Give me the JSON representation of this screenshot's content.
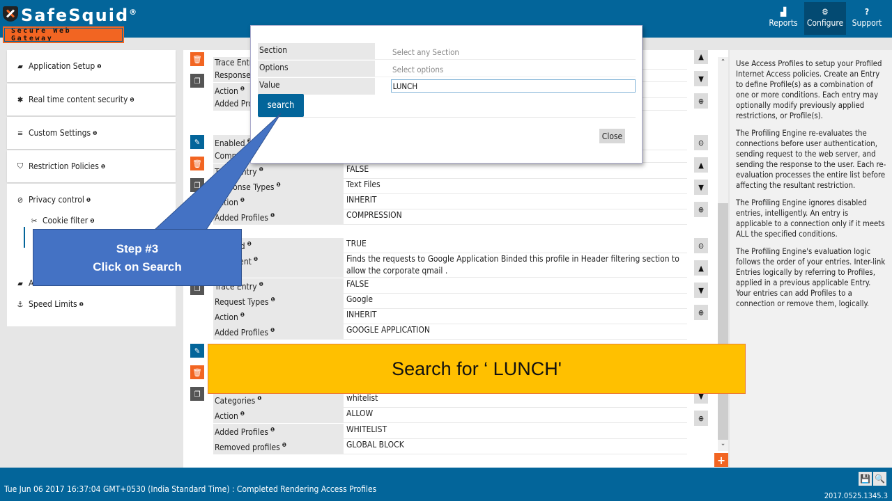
{
  "header": {
    "logo_name": "SafeSquid",
    "logo_reg": "®",
    "logo_tagline": "Secure Web Gateway",
    "nav": [
      {
        "label": "Reports",
        "icon": "chart-icon",
        "glyph": "▟",
        "active": false
      },
      {
        "label": "Configure",
        "icon": "cogs-icon",
        "glyph": "⚙",
        "active": true
      },
      {
        "label": "Support",
        "icon": "question-icon",
        "glyph": "?",
        "active": false
      }
    ]
  },
  "sidebar": {
    "cards": [
      {
        "label": "Application Setup",
        "glyph": "▰"
      },
      {
        "label": "Real time content security",
        "glyph": "✱"
      },
      {
        "label": "Custom Settings",
        "glyph": "≡"
      },
      {
        "label": "Restriction Policies",
        "glyph": "⛉"
      }
    ],
    "group": {
      "label": "Privacy control",
      "glyph": "⊘",
      "items": [
        {
          "label": "Cookie filter",
          "glyph": "✂",
          "sub": true
        },
        {
          "label": "",
          "glyph": "",
          "sub": true
        },
        {
          "label": "",
          "glyph": "",
          "sub": true
        },
        {
          "label": "Access Profiles",
          "glyph": "▰",
          "sub": false
        },
        {
          "label": "Speed Limits",
          "glyph": "⚓",
          "sub": false
        }
      ]
    },
    "info_glyph": "❶"
  },
  "entries": [
    {
      "rows": [
        {
          "k": "Trace Entry",
          "v": ""
        },
        {
          "k": "Response Types",
          "v": ""
        },
        {
          "k": "Action",
          "v": ""
        },
        {
          "k": "Added Profiles",
          "v": ""
        }
      ]
    },
    {
      "rows": [
        {
          "k": "Enabled",
          "v": ""
        },
        {
          "k": "Comment",
          "v": ""
        },
        {
          "k": "Trace Entry",
          "v": "FALSE"
        },
        {
          "k": "Response Types",
          "v": "Text Files"
        },
        {
          "k": "Action",
          "v": "INHERIT"
        },
        {
          "k": "Added Profiles",
          "v": "COMPRESSION"
        }
      ]
    },
    {
      "rows": [
        {
          "k": "Enabled",
          "v": "TRUE"
        },
        {
          "k": "Comment",
          "v": "Finds the requests to Google Application Binded this profile in Header filtering section to allow the corporate qmail ."
        },
        {
          "k": "Trace Entry",
          "v": "FALSE"
        },
        {
          "k": "Request Types",
          "v": "Google"
        },
        {
          "k": "Action",
          "v": "INHERIT"
        },
        {
          "k": "Added Profiles",
          "v": "GOOGLE APPLICATION"
        }
      ]
    },
    {
      "rows": [
        {
          "k": "Categories",
          "v": "whitelist"
        },
        {
          "k": "Action",
          "v": "ALLOW"
        },
        {
          "k": "Added Profiles",
          "v": "WHITELIST"
        },
        {
          "k": "Removed profiles",
          "v": "GLOBAL BLOCK"
        }
      ]
    }
  ],
  "help": {
    "paragraphs": [
      "Use Access Profiles to setup your Profiled Internet Access policies. Create an Entry to define Profile(s) as a combination of one or more conditions. Each entry may optionally modify previously applied restrictions, or Profile(s).",
      "The Profiling Engine re-evaluates the connections before user authentication, sending request to the web server, and sending the response to the user. Each re-evaluation processes the entire list before affecting the resultant restriction.",
      "The Profiling Engine ignores disabled entries, intelligently. An entry is applicable to a connection only if it meets ALL the specified conditions.",
      "The Profiling Engine's evaluation logic follows the order of your entries. Inter-link Entries logically by referring to Profiles, applied in a previous applicable Entry. Your entries can add Profiles to a connection or remove them, logically."
    ]
  },
  "modal": {
    "section_label": "Section",
    "section_placeholder": "Select any Section",
    "options_label": "Options",
    "options_placeholder": "Select options",
    "value_label": "Value",
    "value": "LUNCH",
    "search_label": "search",
    "close_label": "Close"
  },
  "footer": {
    "status": "Tue Jun 06 2017 16:37:04 GMT+0530 (India Standard Time) : Completed Rendering Access Profiles",
    "version": "2017.0525.1345.3"
  },
  "annotations": {
    "step_title": "Step #3",
    "step_text": "Click on Search",
    "banner": "Search for ‘ LUNCH'"
  }
}
